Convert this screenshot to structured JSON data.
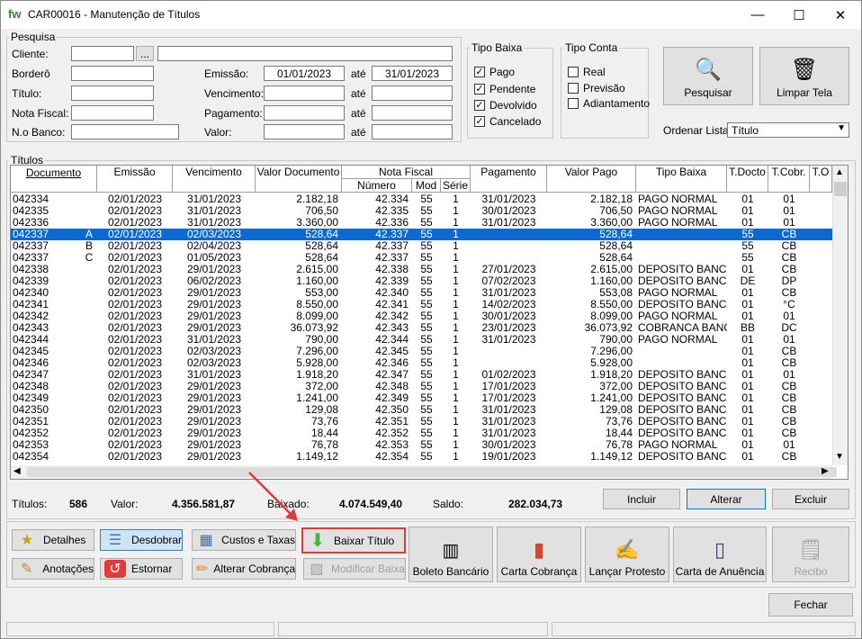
{
  "window": {
    "title": "CAR00016 - Manutenção de Títulos",
    "app_icon": "fw",
    "min": "—",
    "max": "☐",
    "close": "✕"
  },
  "search": {
    "legend": "Pesquisa",
    "cliente": "Cliente:",
    "bordero": "Borderô",
    "titulo": "Título:",
    "nota_fiscal": "Nota Fiscal:",
    "no_banco": "N.o Banco:",
    "emissao": "Emissão:",
    "vencimento": "Vencimento:",
    "pagamento": "Pagamento:",
    "valor": "Valor:",
    "ate": "até",
    "emissao_from": "01/01/2023",
    "emissao_to": "31/01/2023",
    "dots": "..."
  },
  "tipo_baixa": {
    "legend": "Tipo Baixa",
    "items": [
      {
        "label": "Pago",
        "checked": "✓"
      },
      {
        "label": "Pendente",
        "checked": "✓"
      },
      {
        "label": "Devolvido",
        "checked": "✓"
      },
      {
        "label": "Cancelado",
        "checked": "✓"
      }
    ]
  },
  "tipo_conta": {
    "legend": "Tipo Conta",
    "items": [
      {
        "label": "Real",
        "checked": ""
      },
      {
        "label": "Previsão",
        "checked": ""
      },
      {
        "label": "Adiantamento",
        "checked": ""
      }
    ]
  },
  "actions": {
    "pesquisar": "Pesquisar",
    "limpar": "Limpar Tela",
    "ordenar_label": "Ordenar Lista:",
    "ordenar_value": "Título"
  },
  "titulos": {
    "legend": "Títulos",
    "headers": {
      "documento": "Documento",
      "emissao": "Emissão",
      "vencimento": "Vencimento",
      "valor_documento": "Valor Documento",
      "nota_fiscal": "Nota Fiscal",
      "numero": "Número",
      "mod": "Mod",
      "serie": "Série",
      "pagamento": "Pagamento",
      "valor_pago": "Valor Pago",
      "tipo_baixa": "Tipo Baixa",
      "tdocto": "T.Docto",
      "tcobr": "T.Cobr.",
      "to": "T.O"
    },
    "rows": [
      [
        "042334",
        "",
        "02/01/2023",
        "31/01/2023",
        "2.182,18",
        "42.334",
        "55",
        "1",
        "31/01/2023",
        "2.182,18",
        "PAGO NORMAL",
        "01",
        "01"
      ],
      [
        "042335",
        "",
        "02/01/2023",
        "31/01/2023",
        "706,50",
        "42.335",
        "55",
        "1",
        "30/01/2023",
        "706,50",
        "PAGO NORMAL",
        "01",
        "01"
      ],
      [
        "042336",
        "",
        "02/01/2023",
        "31/01/2023",
        "3.360,00",
        "42.336",
        "55",
        "1",
        "31/01/2023",
        "3.360,00",
        "PAGO NORMAL",
        "01",
        "01"
      ],
      [
        "042337",
        "A",
        "02/01/2023",
        "02/03/2023",
        "528,64",
        "42.337",
        "55",
        "1",
        "",
        "528,64",
        "",
        "55",
        "CB"
      ],
      [
        "042337",
        "B",
        "02/01/2023",
        "02/04/2023",
        "528,64",
        "42.337",
        "55",
        "1",
        "",
        "528,64",
        "",
        "55",
        "CB"
      ],
      [
        "042337",
        "C",
        "02/01/2023",
        "01/05/2023",
        "528,64",
        "42.337",
        "55",
        "1",
        "",
        "528,64",
        "",
        "55",
        "CB"
      ],
      [
        "042338",
        "",
        "02/01/2023",
        "29/01/2023",
        "2.615,00",
        "42.338",
        "55",
        "1",
        "27/01/2023",
        "2.615,00",
        "DEPOSITO BANCA",
        "01",
        "CB"
      ],
      [
        "042339",
        "",
        "02/01/2023",
        "06/02/2023",
        "1.160,00",
        "42.339",
        "55",
        "1",
        "07/02/2023",
        "1.160,00",
        "DEPOSITO BANCA",
        "DE",
        "DP"
      ],
      [
        "042340",
        "",
        "02/01/2023",
        "29/01/2023",
        "553,00",
        "42.340",
        "55",
        "1",
        "31/01/2023",
        "553,08",
        "PAGO NORMAL",
        "01",
        "CB"
      ],
      [
        "042341",
        "",
        "02/01/2023",
        "29/01/2023",
        "8.550,00",
        "42.341",
        "55",
        "1",
        "14/02/2023",
        "8.550,00",
        "DEPOSITO BANCA",
        "01",
        "°C"
      ],
      [
        "042342",
        "",
        "02/01/2023",
        "29/01/2023",
        "8.099,00",
        "42.342",
        "55",
        "1",
        "30/01/2023",
        "8.099,00",
        "PAGO NORMAL",
        "01",
        "01"
      ],
      [
        "042343",
        "",
        "02/01/2023",
        "29/01/2023",
        "36.073,92",
        "42.343",
        "55",
        "1",
        "23/01/2023",
        "36.073,92",
        "COBRANCA BANCA",
        "BB",
        "DC"
      ],
      [
        "042344",
        "",
        "02/01/2023",
        "31/01/2023",
        "790,00",
        "42.344",
        "55",
        "1",
        "31/01/2023",
        "790,00",
        "PAGO NORMAL",
        "01",
        "01"
      ],
      [
        "042345",
        "",
        "02/01/2023",
        "02/03/2023",
        "7.296,00",
        "42.345",
        "55",
        "1",
        "",
        "7.296,00",
        "",
        "01",
        "CB"
      ],
      [
        "042346",
        "",
        "02/01/2023",
        "02/03/2023",
        "5.928,00",
        "42.346",
        "55",
        "1",
        "",
        "5.928,00",
        "",
        "01",
        "CB"
      ],
      [
        "042347",
        "",
        "02/01/2023",
        "31/01/2023",
        "1.918,20",
        "42.347",
        "55",
        "1",
        "01/02/2023",
        "1.918,20",
        "DEPOSITO BANCA",
        "01",
        "01"
      ],
      [
        "042348",
        "",
        "02/01/2023",
        "29/01/2023",
        "372,00",
        "42.348",
        "55",
        "1",
        "17/01/2023",
        "372,00",
        "DEPOSITO BANCA",
        "01",
        "CB"
      ],
      [
        "042349",
        "",
        "02/01/2023",
        "29/01/2023",
        "1.241,00",
        "42.349",
        "55",
        "1",
        "17/01/2023",
        "1.241,00",
        "DEPOSITO BANCA",
        "01",
        "CB"
      ],
      [
        "042350",
        "",
        "02/01/2023",
        "29/01/2023",
        "129,08",
        "42.350",
        "55",
        "1",
        "31/01/2023",
        "129,08",
        "DEPOSITO BANCA",
        "01",
        "CB"
      ],
      [
        "042351",
        "",
        "02/01/2023",
        "29/01/2023",
        "73,76",
        "42.351",
        "55",
        "1",
        "31/01/2023",
        "73,76",
        "DEPOSITO BANCA",
        "01",
        "CB"
      ],
      [
        "042352",
        "",
        "02/01/2023",
        "29/01/2023",
        "18,44",
        "42.352",
        "55",
        "1",
        "31/01/2023",
        "18,44",
        "DEPOSITO BANCA",
        "01",
        "CB"
      ],
      [
        "042353",
        "",
        "02/01/2023",
        "29/01/2023",
        "76,78",
        "42.353",
        "55",
        "1",
        "30/01/2023",
        "76,78",
        "PAGO NORMAL",
        "01",
        "01"
      ],
      [
        "042354",
        "",
        "02/01/2023",
        "29/01/2023",
        "1.149,12",
        "42.354",
        "55",
        "1",
        "19/01/2023",
        "1.149,12",
        "DEPOSITO BANCA",
        "01",
        "CB"
      ]
    ]
  },
  "summary": {
    "titulos_label": "Títulos:",
    "titulos_value": "586",
    "valor_label": "Valor:",
    "valor_value": "4.356.581,87",
    "baixado_label": "Baixado:",
    "baixado_value": "4.074.549,40",
    "saldo_label": "Saldo:",
    "saldo_value": "282.034,73"
  },
  "grid_buttons": {
    "incluir": "Incluir",
    "alterar": "Alterar",
    "excluir": "Excluir"
  },
  "toolbar": {
    "detalhes": "Detalhes",
    "desdobrar": "Desdobrar",
    "custos": "Custos e Taxas",
    "baixar": "Baixar Título",
    "anotacoes": "Anotações",
    "estornar": "Estornar",
    "alterar_cobranca": "Alterar Cobrança",
    "modificar_baixa": "Modificar Baixa",
    "boleto": "Boleto Bancário",
    "carta_cobranca": "Carta Cobrança",
    "lancar_protesto": "Lançar Protesto",
    "carta_anuencia": "Carta de Anuência",
    "recibo": "Recibo",
    "fechar": "Fechar"
  },
  "colors": {
    "selection": "#0a6ad4",
    "highlight_border": "#e53935",
    "arrow": "#e53935"
  },
  "selected_row_index": 3
}
